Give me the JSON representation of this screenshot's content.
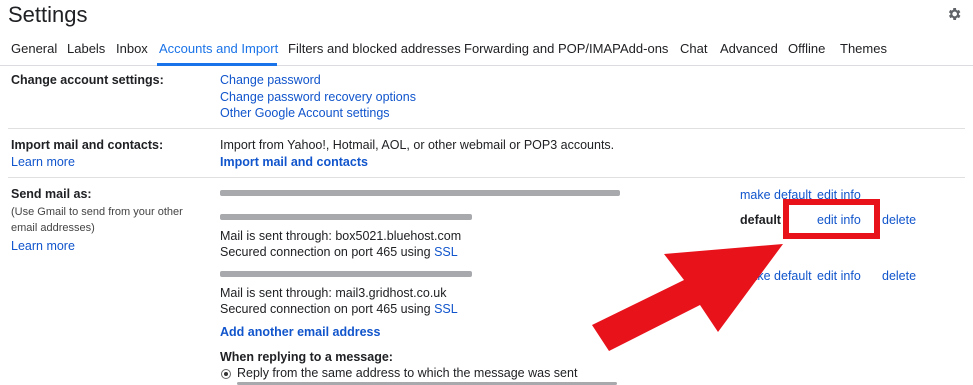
{
  "header": {
    "title": "Settings",
    "gear_icon": "gear-icon"
  },
  "tabs": [
    {
      "label": "General"
    },
    {
      "label": "Labels"
    },
    {
      "label": "Inbox"
    },
    {
      "label": "Accounts and Import",
      "active": true
    },
    {
      "label": "Filters and blocked addresses"
    },
    {
      "label": "Forwarding and POP/IMAP"
    },
    {
      "label": "Add-ons"
    },
    {
      "label": "Chat"
    },
    {
      "label": "Advanced"
    },
    {
      "label": "Offline"
    },
    {
      "label": "Themes"
    }
  ],
  "change_account": {
    "label": "Change account settings:",
    "links": [
      "Change password",
      "Change password recovery options",
      "Other Google Account settings"
    ]
  },
  "import_mail": {
    "label": "Import mail and contacts:",
    "learn_more": "Learn more",
    "description": "Import from Yahoo!, Hotmail, AOL, or other webmail or POP3 accounts.",
    "action": "Import mail and contacts"
  },
  "send_mail": {
    "label": "Send mail as:",
    "note": "(Use Gmail to send from your other email addresses)",
    "learn_more": "Learn more",
    "row1": {
      "make_default": "make default",
      "edit_info": "edit info"
    },
    "row2": {
      "default_label": "default",
      "edit_info": "edit info",
      "delete": "delete",
      "server": "Mail is sent through: box5021.bluehost.com",
      "secured": "Secured connection on port 465 using",
      "ssl": "SSL"
    },
    "row3": {
      "make_default": "make default",
      "edit_info": "edit info",
      "delete": "delete",
      "server": "Mail is sent through: mail3.gridhost.co.uk",
      "secured": "Secured connection on port 465 using",
      "ssl": "SSL"
    },
    "add_another": "Add another email address",
    "replying_label": "When replying to a message:",
    "reply_option": "Reply from the same address to which the message was sent"
  },
  "colors": {
    "accent": "#1a73e8",
    "link": "#1155cc",
    "annotation": "#e8121b"
  }
}
